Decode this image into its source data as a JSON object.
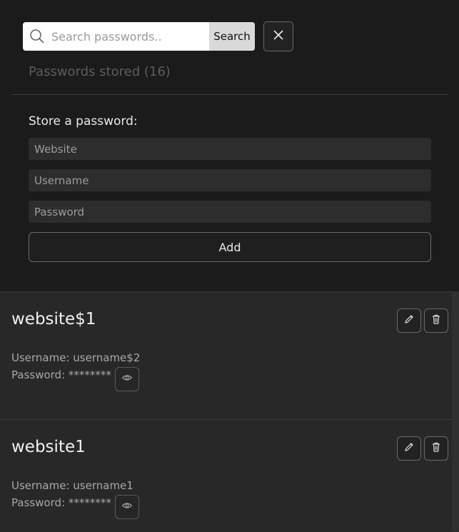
{
  "search": {
    "placeholder": "Search passwords..",
    "button_label": "Search"
  },
  "header": {
    "stored_label": "Passwords stored (16)"
  },
  "form": {
    "label": "Store a password:",
    "website_placeholder": "Website",
    "username_placeholder": "Username",
    "password_placeholder": "Password",
    "add_label": "Add"
  },
  "entries": [
    {
      "website": "website$1",
      "username_line": "Username: username$2",
      "password_line": "Password: ********"
    },
    {
      "website": "website1",
      "username_line": "Username: username1",
      "password_line": "Password: ********"
    }
  ],
  "icons": {
    "search": "search-icon",
    "close": "close-icon",
    "edit": "pencil-icon",
    "delete": "trash-icon",
    "reveal": "eye-icon"
  }
}
